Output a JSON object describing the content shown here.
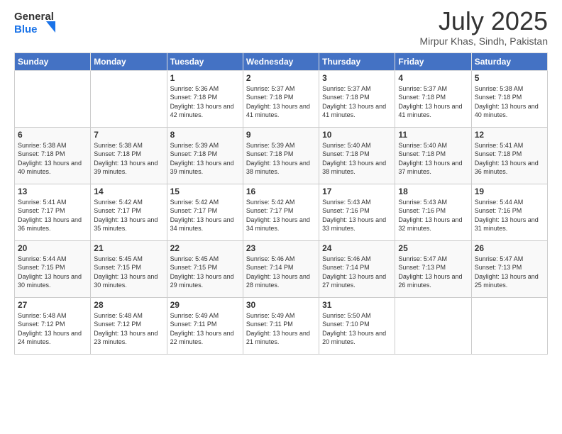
{
  "logo": {
    "line1": "General",
    "line2": "Blue"
  },
  "title": "July 2025",
  "location": "Mirpur Khas, Sindh, Pakistan",
  "weekdays": [
    "Sunday",
    "Monday",
    "Tuesday",
    "Wednesday",
    "Thursday",
    "Friday",
    "Saturday"
  ],
  "weeks": [
    [
      {
        "day": "",
        "info": ""
      },
      {
        "day": "",
        "info": ""
      },
      {
        "day": "1",
        "info": "Sunrise: 5:36 AM\nSunset: 7:18 PM\nDaylight: 13 hours and 42 minutes."
      },
      {
        "day": "2",
        "info": "Sunrise: 5:37 AM\nSunset: 7:18 PM\nDaylight: 13 hours and 41 minutes."
      },
      {
        "day": "3",
        "info": "Sunrise: 5:37 AM\nSunset: 7:18 PM\nDaylight: 13 hours and 41 minutes."
      },
      {
        "day": "4",
        "info": "Sunrise: 5:37 AM\nSunset: 7:18 PM\nDaylight: 13 hours and 41 minutes."
      },
      {
        "day": "5",
        "info": "Sunrise: 5:38 AM\nSunset: 7:18 PM\nDaylight: 13 hours and 40 minutes."
      }
    ],
    [
      {
        "day": "6",
        "info": "Sunrise: 5:38 AM\nSunset: 7:18 PM\nDaylight: 13 hours and 40 minutes."
      },
      {
        "day": "7",
        "info": "Sunrise: 5:38 AM\nSunset: 7:18 PM\nDaylight: 13 hours and 39 minutes."
      },
      {
        "day": "8",
        "info": "Sunrise: 5:39 AM\nSunset: 7:18 PM\nDaylight: 13 hours and 39 minutes."
      },
      {
        "day": "9",
        "info": "Sunrise: 5:39 AM\nSunset: 7:18 PM\nDaylight: 13 hours and 38 minutes."
      },
      {
        "day": "10",
        "info": "Sunrise: 5:40 AM\nSunset: 7:18 PM\nDaylight: 13 hours and 38 minutes."
      },
      {
        "day": "11",
        "info": "Sunrise: 5:40 AM\nSunset: 7:18 PM\nDaylight: 13 hours and 37 minutes."
      },
      {
        "day": "12",
        "info": "Sunrise: 5:41 AM\nSunset: 7:18 PM\nDaylight: 13 hours and 36 minutes."
      }
    ],
    [
      {
        "day": "13",
        "info": "Sunrise: 5:41 AM\nSunset: 7:17 PM\nDaylight: 13 hours and 36 minutes."
      },
      {
        "day": "14",
        "info": "Sunrise: 5:42 AM\nSunset: 7:17 PM\nDaylight: 13 hours and 35 minutes."
      },
      {
        "day": "15",
        "info": "Sunrise: 5:42 AM\nSunset: 7:17 PM\nDaylight: 13 hours and 34 minutes."
      },
      {
        "day": "16",
        "info": "Sunrise: 5:42 AM\nSunset: 7:17 PM\nDaylight: 13 hours and 34 minutes."
      },
      {
        "day": "17",
        "info": "Sunrise: 5:43 AM\nSunset: 7:16 PM\nDaylight: 13 hours and 33 minutes."
      },
      {
        "day": "18",
        "info": "Sunrise: 5:43 AM\nSunset: 7:16 PM\nDaylight: 13 hours and 32 minutes."
      },
      {
        "day": "19",
        "info": "Sunrise: 5:44 AM\nSunset: 7:16 PM\nDaylight: 13 hours and 31 minutes."
      }
    ],
    [
      {
        "day": "20",
        "info": "Sunrise: 5:44 AM\nSunset: 7:15 PM\nDaylight: 13 hours and 30 minutes."
      },
      {
        "day": "21",
        "info": "Sunrise: 5:45 AM\nSunset: 7:15 PM\nDaylight: 13 hours and 30 minutes."
      },
      {
        "day": "22",
        "info": "Sunrise: 5:45 AM\nSunset: 7:15 PM\nDaylight: 13 hours and 29 minutes."
      },
      {
        "day": "23",
        "info": "Sunrise: 5:46 AM\nSunset: 7:14 PM\nDaylight: 13 hours and 28 minutes."
      },
      {
        "day": "24",
        "info": "Sunrise: 5:46 AM\nSunset: 7:14 PM\nDaylight: 13 hours and 27 minutes."
      },
      {
        "day": "25",
        "info": "Sunrise: 5:47 AM\nSunset: 7:13 PM\nDaylight: 13 hours and 26 minutes."
      },
      {
        "day": "26",
        "info": "Sunrise: 5:47 AM\nSunset: 7:13 PM\nDaylight: 13 hours and 25 minutes."
      }
    ],
    [
      {
        "day": "27",
        "info": "Sunrise: 5:48 AM\nSunset: 7:12 PM\nDaylight: 13 hours and 24 minutes."
      },
      {
        "day": "28",
        "info": "Sunrise: 5:48 AM\nSunset: 7:12 PM\nDaylight: 13 hours and 23 minutes."
      },
      {
        "day": "29",
        "info": "Sunrise: 5:49 AM\nSunset: 7:11 PM\nDaylight: 13 hours and 22 minutes."
      },
      {
        "day": "30",
        "info": "Sunrise: 5:49 AM\nSunset: 7:11 PM\nDaylight: 13 hours and 21 minutes."
      },
      {
        "day": "31",
        "info": "Sunrise: 5:50 AM\nSunset: 7:10 PM\nDaylight: 13 hours and 20 minutes."
      },
      {
        "day": "",
        "info": ""
      },
      {
        "day": "",
        "info": ""
      }
    ]
  ]
}
